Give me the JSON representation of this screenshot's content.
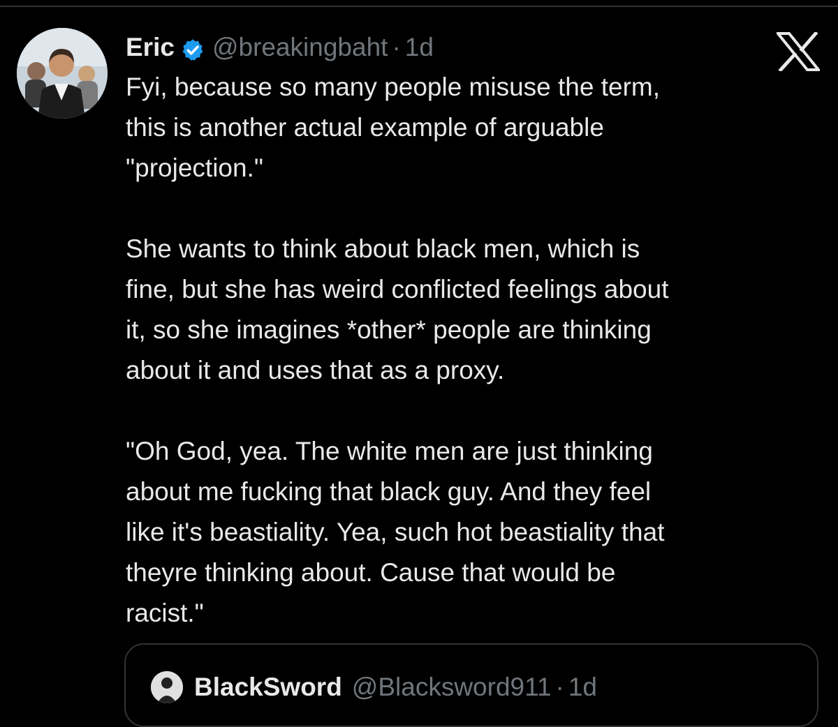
{
  "tweet": {
    "display_name": "Eric",
    "handle": "@breakingbaht",
    "separator": "·",
    "time": "1d",
    "verified": true,
    "paragraphs": [
      "Fyi, because so many people misuse the term,\nthis is another actual example of arguable\n\"projection.\"",
      "She wants to think about black men, which is\nfine, but she has weird conflicted feelings about\nit, so she imagines *other* people are thinking\nabout it and uses that as a proxy.",
      "\"Oh God, yea. The white men are just thinking\nabout me fucking that black guy. And they feel\nlike it's beastiality. Yea, such hot beastiality that\ntheyre thinking about. Cause that would be\nracist.\""
    ]
  },
  "quoted_tweet": {
    "display_name": "BlackSword",
    "handle": "@Blacksword911",
    "separator": "·",
    "time": "1d"
  },
  "icons": {
    "verified": "verified-badge-icon",
    "brand": "x-logo-icon"
  },
  "colors": {
    "background": "#000000",
    "text_primary": "#e7e9ea",
    "text_secondary": "#71767b",
    "verified_blue": "#1d9bf0",
    "border": "#2f3336"
  }
}
